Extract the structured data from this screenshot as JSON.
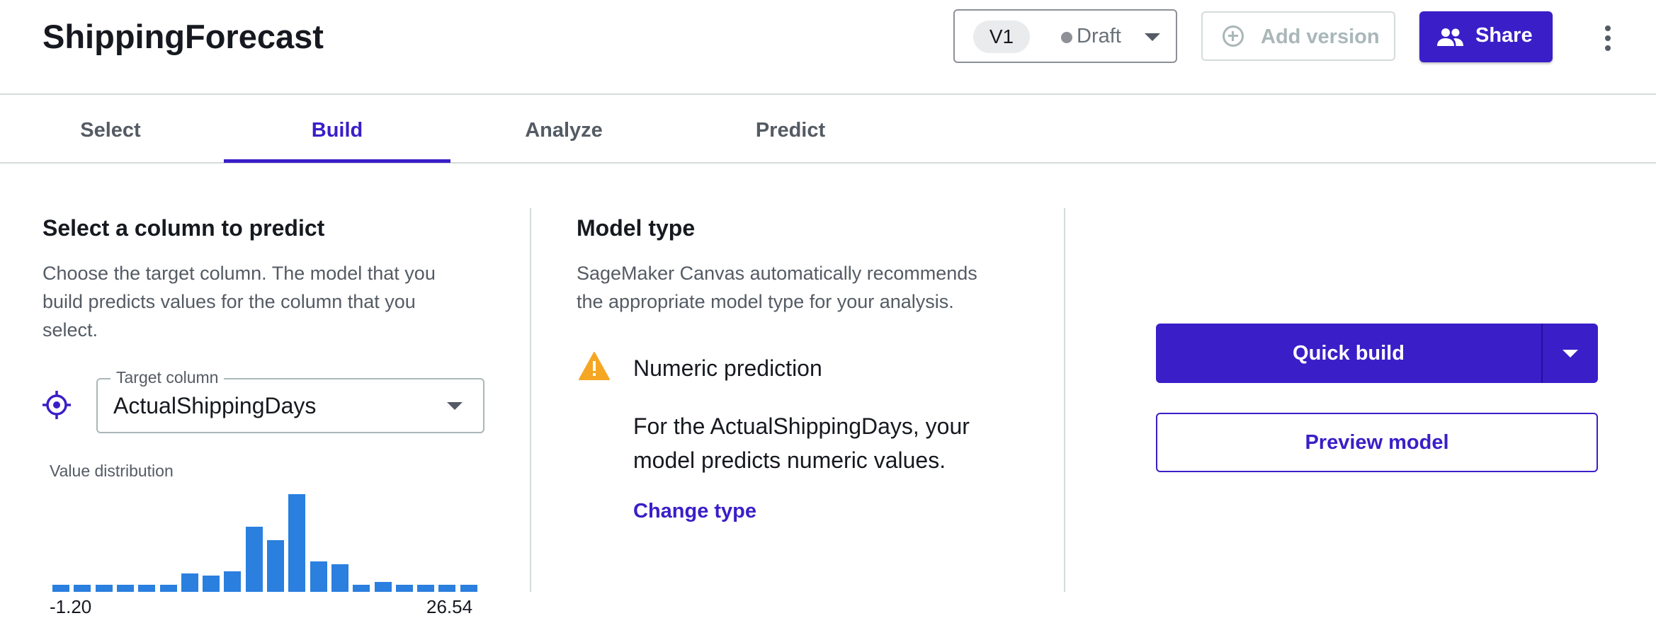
{
  "app": {
    "title": "ShippingForecast"
  },
  "version": {
    "label": "V1",
    "status": "Draft"
  },
  "header": {
    "add_version_label": "Add version",
    "share_label": "Share"
  },
  "tabs": [
    {
      "label": "Select"
    },
    {
      "label": "Build",
      "active": true
    },
    {
      "label": "Analyze"
    },
    {
      "label": "Predict"
    }
  ],
  "target": {
    "title": "Select a column to predict",
    "description_lines": [
      "Choose the target column. The model that you",
      "build predicts values for the column that you",
      "select."
    ],
    "field_label": "Target column",
    "value": "ActualShippingDays",
    "distribution_label": "Value distribution",
    "histogram": {
      "x_min": "-1.20",
      "x_max": "26.54",
      "relative_counts": [
        0.07,
        0.07,
        0.07,
        0.07,
        0.07,
        0.07,
        0.19,
        0.17,
        0.21,
        0.67,
        0.53,
        1.0,
        0.31,
        0.28,
        0.07,
        0.1,
        0.07,
        0.07,
        0.07,
        0.07
      ]
    }
  },
  "model_type": {
    "title": "Model type",
    "description_lines": [
      "SageMaker Canvas automatically recommends",
      "the appropriate model type for your analysis."
    ],
    "type_label": "Numeric prediction",
    "type_description_lines": [
      "For the ActualShippingDays, your",
      "model predicts numeric values."
    ],
    "change_label": "Change type"
  },
  "actions": {
    "quick_build_label": "Quick build",
    "preview_label": "Preview model"
  },
  "colors": {
    "accent": "#3a1ec8",
    "bar": "#2b7fdf",
    "warning": "#f5a623"
  }
}
